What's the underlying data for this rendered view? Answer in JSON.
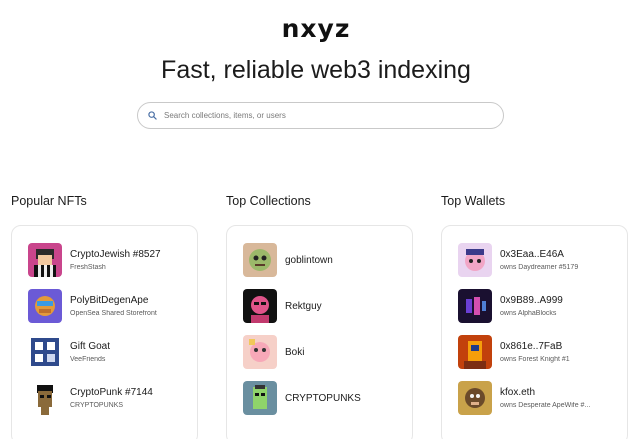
{
  "header": {
    "logo": "nxyz",
    "tagline": "Fast, reliable web3 indexing"
  },
  "search": {
    "placeholder": "Search collections, items, or users",
    "icon": "search-icon"
  },
  "popular_nfts": {
    "title": "Popular NFTs",
    "items": [
      {
        "name": "CryptoJewish #8527",
        "sub": "FreshStash"
      },
      {
        "name": "PolyBitDegenApe",
        "sub": "OpenSea Shared Storefront"
      },
      {
        "name": "Gift Goat",
        "sub": "VeeFriends"
      },
      {
        "name": "CryptoPunk #7144",
        "sub": "CRYPTOPUNKS"
      }
    ]
  },
  "top_collections": {
    "title": "Top Collections",
    "items": [
      {
        "name": "goblintown"
      },
      {
        "name": "Rektguy"
      },
      {
        "name": "Boki"
      },
      {
        "name": "CRYPTOPUNKS"
      }
    ]
  },
  "top_wallets": {
    "title": "Top Wallets",
    "items": [
      {
        "name": "0x3Eaa..E46A",
        "sub": "owns Daydreamer #5179"
      },
      {
        "name": "0x9B89..A999",
        "sub": "owns AlphaBlocks"
      },
      {
        "name": "0x861e..7FaB",
        "sub": "owns Forest Knight #1"
      },
      {
        "name": "kfox.eth",
        "sub": "owns Desperate ApeWife #..."
      }
    ]
  },
  "colors": {
    "text": "#1b1b1b",
    "muted": "#5a5a5a",
    "border": "#e6e6e6"
  }
}
